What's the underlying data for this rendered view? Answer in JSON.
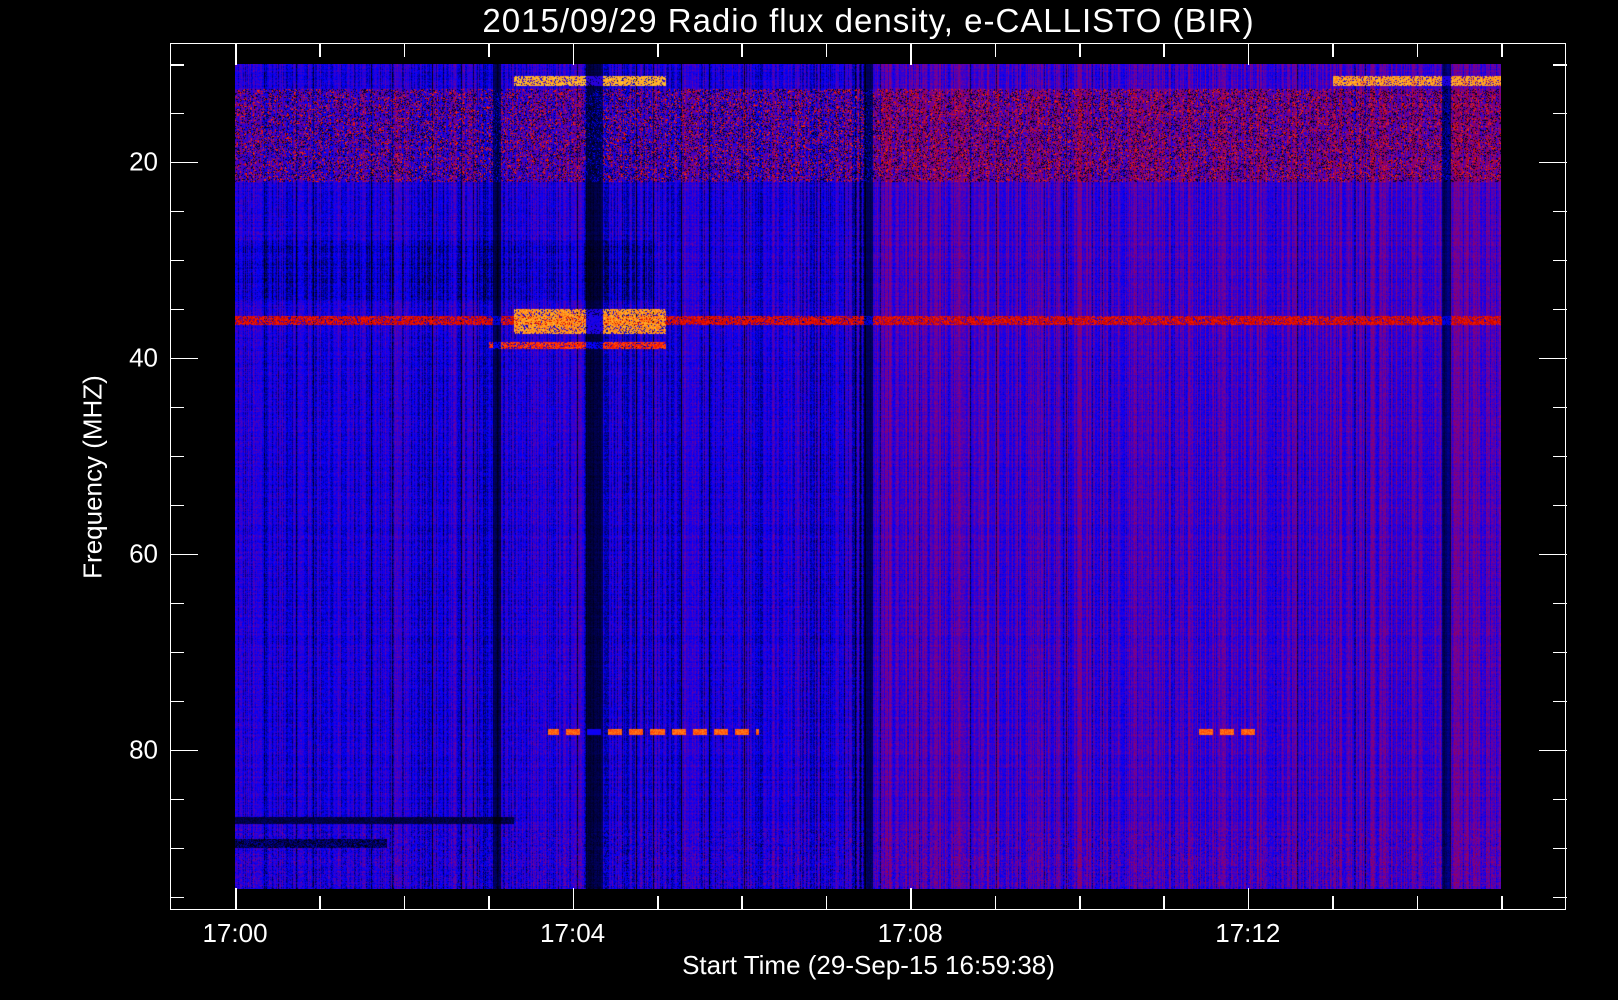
{
  "chart_data": {
    "type": "heatmap",
    "title": "2015/09/29  Radio flux density, e-CALLISTO (BIR)",
    "xlabel": "Start Time (29-Sep-15 16:59:38)",
    "ylabel": "Frequency (MHZ)",
    "x_unit": "minutes after 17:00",
    "x_range": [
      0,
      15
    ],
    "x_axis_range": [
      -0.77,
      16.1
    ],
    "y_range": [
      10,
      94.2
    ],
    "y_axis_range": [
      7.9,
      96.5
    ],
    "y_inverted": true,
    "x_ticks": [
      {
        "value": 0,
        "label": "17:00"
      },
      {
        "value": 4,
        "label": "17:04"
      },
      {
        "value": 8,
        "label": "17:08"
      },
      {
        "value": 12,
        "label": "17:12"
      }
    ],
    "x_minor_step": 1,
    "y_ticks": [
      {
        "value": 20,
        "label": "20"
      },
      {
        "value": 40,
        "label": "40"
      },
      {
        "value": 60,
        "label": "60"
      },
      {
        "value": 80,
        "label": "80"
      }
    ],
    "y_minor_step": 5,
    "colormap": [
      "#000000",
      "#0000ff",
      "#7a0090",
      "#c00000",
      "#ff2000",
      "#ffa020",
      "#ffe040"
    ],
    "features": [
      {
        "kind": "bright-band",
        "freq": [
          11.2,
          12.2
        ],
        "time": [
          3.3,
          5.1
        ],
        "level": 0.95
      },
      {
        "kind": "bright-band",
        "freq": [
          11.2,
          12.2
        ],
        "time": [
          13.0,
          15.0
        ],
        "level": 0.92
      },
      {
        "kind": "noisy-band",
        "freq": [
          12.5,
          22
        ],
        "time": [
          0,
          15
        ],
        "level": 0.6
      },
      {
        "kind": "bright-band",
        "freq": [
          35.7,
          36.6
        ],
        "time": [
          0,
          15
        ],
        "level": 0.65
      },
      {
        "kind": "bright-band",
        "freq": [
          35,
          37.5
        ],
        "time": [
          3.3,
          5.1
        ],
        "level": 0.9
      },
      {
        "kind": "bright-band",
        "freq": [
          38.3,
          39.0
        ],
        "time": [
          3.0,
          5.1
        ],
        "level": 0.75
      },
      {
        "kind": "dots",
        "freq": [
          77.8,
          78.4
        ],
        "time": [
          3.7,
          6.2
        ],
        "level": 0.8
      },
      {
        "kind": "dots",
        "freq": [
          77.8,
          78.4
        ],
        "time": [
          11.4,
          12.1
        ],
        "level": 0.8
      },
      {
        "kind": "dark-band",
        "freq": [
          86.8,
          87.5
        ],
        "time": [
          0,
          3.3
        ],
        "level": 0
      },
      {
        "kind": "dark-band",
        "freq": [
          89,
          90
        ],
        "time": [
          0,
          1.8
        ],
        "level": 0
      },
      {
        "kind": "dark-column",
        "time": [
          3.05,
          3.15
        ],
        "level": 0
      },
      {
        "kind": "dark-column",
        "time": [
          4.15,
          4.35
        ],
        "level": 0
      },
      {
        "kind": "dark-column",
        "time": [
          7.45,
          7.55
        ],
        "level": 0
      },
      {
        "kind": "dark-column",
        "time": [
          14.3,
          14.4
        ],
        "level": 0.1
      }
    ]
  }
}
